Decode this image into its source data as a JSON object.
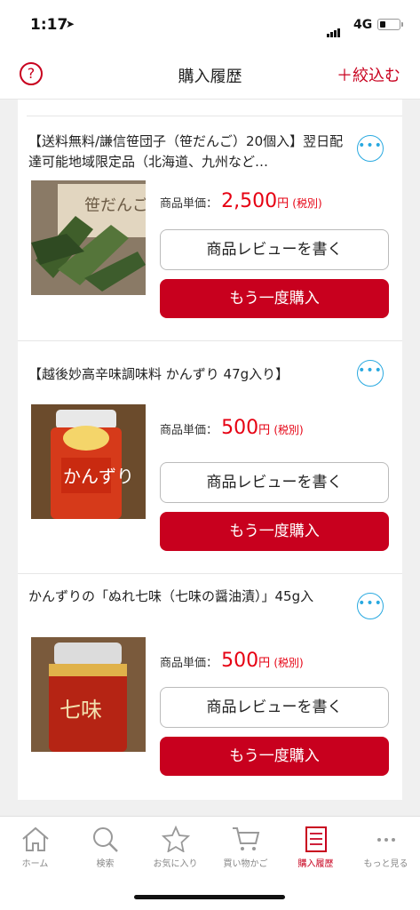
{
  "status_bar": {
    "time": "1:17",
    "location_icon": "location-arrow-icon",
    "network": "4G"
  },
  "header": {
    "title": "購入履歴",
    "help_icon": "help-icon",
    "filter_label": "＋絞込む"
  },
  "items": [
    {
      "title": "【送料無料/謙信笹団子（笹だんご）20個入】翌日配達可能地域限定品（北海道、九州など…",
      "price_label": "商品単価：",
      "price": "2,500",
      "currency": "円",
      "tax": "(税別)",
      "review_label": "商品レビューを書く",
      "rebuy_label": "もう一度購入"
    },
    {
      "title": "【越後妙高辛味調味料 かんずり 47g入り】",
      "price_label": "商品単価：",
      "price": "500",
      "currency": "円",
      "tax": "(税別)",
      "review_label": "商品レビューを書く",
      "rebuy_label": "もう一度購入"
    },
    {
      "title": "かんずりの「ぬれ七味（七味の醤油漬）」45g入",
      "price_label": "商品単価：",
      "price": "500",
      "currency": "円",
      "tax": "(税別)",
      "review_label": "商品レビューを書く",
      "rebuy_label": "もう一度購入"
    }
  ],
  "tab_bar": {
    "tabs": [
      {
        "label": "ホーム",
        "icon": "home-icon"
      },
      {
        "label": "検索",
        "icon": "search-icon"
      },
      {
        "label": "お気に入り",
        "icon": "star-icon"
      },
      {
        "label": "買い物かご",
        "icon": "cart-icon"
      },
      {
        "label": "購入履歴",
        "icon": "history-list-icon",
        "active": true
      },
      {
        "label": "もっと見る",
        "icon": "more-dots-icon"
      }
    ]
  },
  "colors": {
    "brand_red": "#c8001e",
    "price_red": "#e60012",
    "more_blue": "#29a9e0"
  }
}
